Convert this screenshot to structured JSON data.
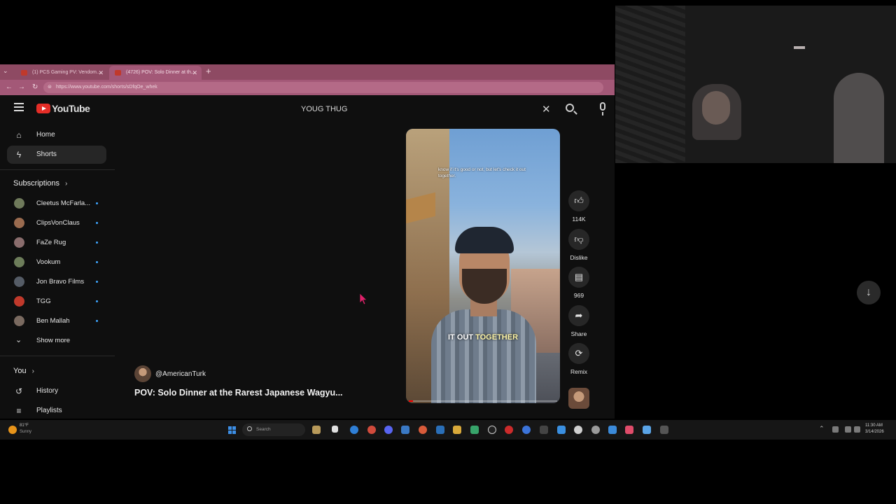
{
  "browser": {
    "tabs": [
      {
        "title": "(1) PCS Gaming PV: Vendom..."
      },
      {
        "title": "(4726) POV: Solo Dinner at th..."
      }
    ],
    "url": "https://www.youtube.com/shorts/sDfqOe_whek"
  },
  "youtube": {
    "logo_text": "YouTube",
    "search": {
      "value": "YOUG THUG"
    },
    "nav": [
      {
        "label": "Home",
        "icon": "home-icon"
      },
      {
        "label": "Shorts",
        "icon": "shorts-icon",
        "active": true
      }
    ],
    "subscriptions": {
      "title": "Subscriptions",
      "items": [
        {
          "name": "Cleetus McFarla...",
          "color": "#6f7a5b"
        },
        {
          "name": "ClipsVonClaus",
          "color": "#9a6b4f"
        },
        {
          "name": "FaZe Rug",
          "color": "#8a6d6d"
        },
        {
          "name": "Vookum",
          "color": "#6d7d5a"
        },
        {
          "name": "Jon Bravo Films",
          "color": "#555c66"
        },
        {
          "name": "TGG",
          "color": "#c0392b"
        },
        {
          "name": "Ben Mallah",
          "color": "#7a6a60"
        }
      ],
      "show_more": "Show more"
    },
    "you": {
      "title": "You",
      "items": [
        {
          "label": "History",
          "icon": "history-icon"
        },
        {
          "label": "Playlists",
          "icon": "playlists-icon"
        }
      ]
    },
    "short": {
      "channel": "@AmericanTurk",
      "title": "POV: Solo Dinner at the Rarest Japanese Wagyu...",
      "caption_top": "know if it's good or not, but let's check it out together.",
      "caption_bottom_a": "IT OUT ",
      "caption_bottom_b": "TOGETHER",
      "progress": 0.03
    },
    "actions": {
      "likes": "114K",
      "dislike": "Dislike",
      "comments": "969",
      "share": "Share",
      "remix": "Remix"
    }
  },
  "taskbar": {
    "weather_temp": "81°F",
    "weather_cond": "Sunny",
    "search_placeholder": "Search",
    "time": "11:30 AM",
    "date": "3/14/2026"
  }
}
